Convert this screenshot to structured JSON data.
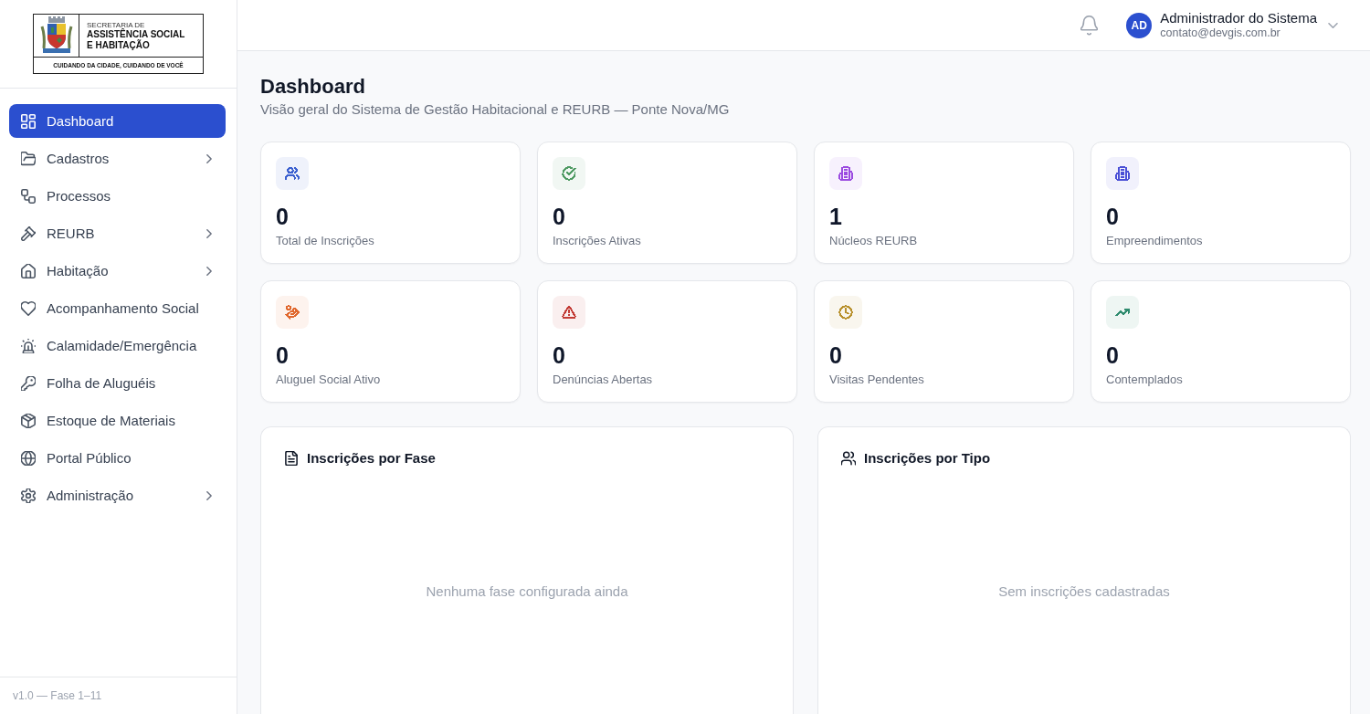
{
  "sidebar": {
    "logo": {
      "caption": "SECRETARIA DE",
      "title_lines": [
        "ASSISTÊNCIA SOCIAL",
        "E HABITAÇÃO"
      ],
      "slogan": "CUIDANDO DA CIDADE, CUIDANDO DE VOCÊ"
    },
    "nav": [
      {
        "label": "Dashboard",
        "selected": true,
        "submenu": false
      },
      {
        "label": "Cadastros",
        "selected": false,
        "submenu": true
      },
      {
        "label": "Processos",
        "selected": false,
        "submenu": false
      },
      {
        "label": "REURB",
        "selected": false,
        "submenu": true
      },
      {
        "label": "Habitação",
        "selected": false,
        "submenu": true
      },
      {
        "label": "Acompanhamento Social",
        "selected": false,
        "submenu": false
      },
      {
        "label": "Calamidade/Emergência",
        "selected": false,
        "submenu": false
      },
      {
        "label": "Folha de Aluguéis",
        "selected": false,
        "submenu": false
      },
      {
        "label": "Estoque de Materiais",
        "selected": false,
        "submenu": false
      },
      {
        "label": "Portal Público",
        "selected": false,
        "submenu": false
      },
      {
        "label": "Administração",
        "selected": false,
        "submenu": true
      }
    ],
    "footer": "v1.0 — Fase 1–11"
  },
  "header": {
    "user": {
      "initials": "AD",
      "name": "Administrador do Sistema",
      "email": "contato@devgis.com.br"
    }
  },
  "page": {
    "title": "Dashboard",
    "subtitle": "Visão geral do Sistema de Gestão Habitacional e REURB — Ponte Nova/MG"
  },
  "stats": [
    {
      "value": "0",
      "label": "Total de Inscrições",
      "color": "#3a5fcf"
    },
    {
      "value": "0",
      "label": "Inscrições Ativas",
      "color": "#4f9a63"
    },
    {
      "value": "1",
      "label": "Núcleos REURB",
      "color": "#9b4be0"
    },
    {
      "value": "0",
      "label": "Empreendimentos",
      "color": "#4a4fd6"
    },
    {
      "value": "0",
      "label": "Aluguel Social Ativo",
      "color": "#e0672d"
    },
    {
      "value": "0",
      "label": "Denúncias Abertas",
      "color": "#c23a34"
    },
    {
      "value": "0",
      "label": "Visitas Pendentes",
      "color": "#b8902c"
    },
    {
      "value": "0",
      "label": "Contemplados",
      "color": "#2e8b6e"
    }
  ],
  "panels": [
    {
      "title": "Inscrições por Fase",
      "empty_message": "Nenhuma fase configurada ainda"
    },
    {
      "title": "Inscrições por Tipo",
      "empty_message": "Sem inscrições cadastradas"
    }
  ]
}
